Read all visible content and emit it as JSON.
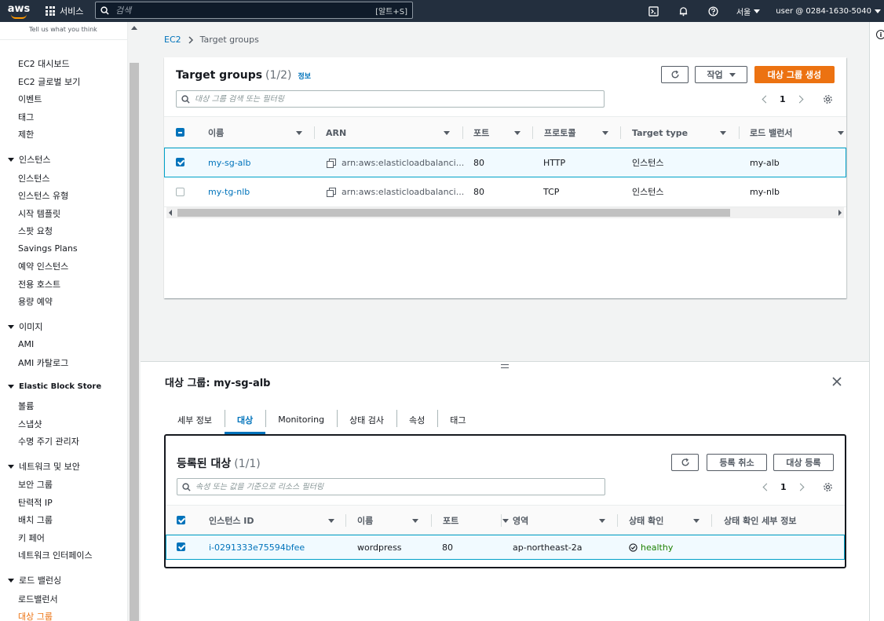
{
  "nav": {
    "logo": "aws",
    "services": "서비스",
    "search_placeholder": "검색",
    "search_shortcut": "[알트+S]",
    "region": "서울",
    "account": "user @ 0284-1630-5040"
  },
  "sidebar": {
    "tell_us": "Tell us what you think",
    "top_items": [
      "EC2 대시보드",
      "EC2 글로벌 보기",
      "이벤트",
      "태그",
      "제한"
    ],
    "sections": [
      {
        "title": "인스턴스",
        "items": [
          "인스턴스",
          "인스턴스 유형",
          "시작 템플릿",
          "스팟 요청",
          "Savings Plans",
          "예약 인스턴스",
          "전용 호스트",
          "용량 예약"
        ]
      },
      {
        "title": "이미지",
        "items": [
          "AMI",
          "AMI 카탈로그"
        ]
      },
      {
        "title": "Elastic Block Store",
        "items": [
          "볼륨",
          "스냅샷",
          "수명 주기 관리자"
        ]
      },
      {
        "title": "네트워크 및 보안",
        "items": [
          "보안 그룹",
          "탄력적 IP",
          "배치 그룹",
          "키 페어",
          "네트워크 인터페이스"
        ]
      },
      {
        "title": "로드 밸런싱",
        "items": [
          "로드밸런서",
          "대상 그룹"
        ]
      }
    ]
  },
  "breadcrumb": {
    "root": "EC2",
    "current": "Target groups"
  },
  "tg": {
    "title": "Target groups",
    "count": "(1/2)",
    "info": "정보",
    "actions_label": "작업",
    "create_label": "대상 그룹 생성",
    "filter_placeholder": "대상 그룹 검색 또는 필터링",
    "page": "1",
    "columns": [
      "이름",
      "ARN",
      "포트",
      "프로토콜",
      "Target type",
      "로드 밸런서"
    ],
    "rows": [
      {
        "name": "my-sg-alb",
        "arn": "arn:aws:elasticloadbalanci...",
        "port": "80",
        "protocol": "HTTP",
        "type": "인스턴스",
        "lb": "my-alb",
        "selected": true
      },
      {
        "name": "my-tg-nlb",
        "arn": "arn:aws:elasticloadbalanci...",
        "port": "80",
        "protocol": "TCP",
        "type": "인스턴스",
        "lb": "my-nlb",
        "selected": false
      }
    ]
  },
  "detail": {
    "title": "대상 그룹: my-sg-alb",
    "tabs": [
      "세부 정보",
      "대상",
      "Monitoring",
      "상태 검사",
      "속성",
      "태그"
    ],
    "active_tab": 1
  },
  "targets": {
    "title": "등록된 대상",
    "count": "(1/1)",
    "deregister_label": "등록 취소",
    "register_label": "대상 등록",
    "filter_placeholder": "속성 또는 값을 기준으로 리소스 필터링",
    "page": "1",
    "columns": [
      "인스턴스 ID",
      "이름",
      "포트",
      "영역",
      "상태 확인",
      "상태 확인 세부 정보"
    ],
    "rows": [
      {
        "id": "i-0291333e75594bfee",
        "name": "wordpress",
        "port": "80",
        "zone": "ap-northeast-2a",
        "health": "healthy",
        "details": ""
      }
    ]
  },
  "colors": {
    "accent": "#ec7211",
    "link": "#0073bb",
    "nav": "#232f3e",
    "healthy": "#1d8102"
  }
}
